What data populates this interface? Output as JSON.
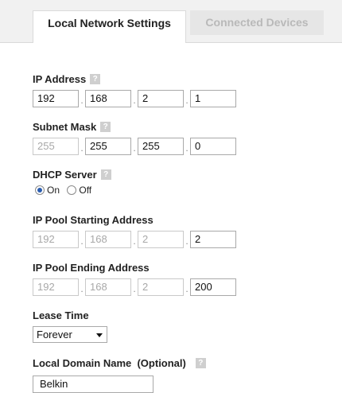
{
  "tabs": [
    {
      "label": "Local Network Settings",
      "active": true
    },
    {
      "label": "Connected Devices",
      "active": false
    }
  ],
  "help_glyph": "?",
  "ip_address": {
    "label": "IP Address",
    "octets": [
      "192",
      "168",
      "2",
      "1"
    ]
  },
  "subnet_mask": {
    "label": "Subnet Mask",
    "octets": [
      "255",
      "255",
      "255",
      "0"
    ]
  },
  "dhcp_server": {
    "label": "DHCP Server",
    "options": [
      "On",
      "Off"
    ],
    "selected": "On"
  },
  "pool_start": {
    "label": "IP Pool Starting Address",
    "octets": [
      "192",
      "168",
      "2",
      "2"
    ]
  },
  "pool_end": {
    "label": "IP Pool Ending Address",
    "octets": [
      "192",
      "168",
      "2",
      "200"
    ]
  },
  "lease_time": {
    "label": "Lease Time",
    "value": "Forever"
  },
  "local_domain": {
    "label": "Local Domain Name  (Optional)",
    "value": "Belkin"
  },
  "colors": {
    "accent_radio": "#2a5db0",
    "inactive_tab_text": "#b9b9b9"
  }
}
